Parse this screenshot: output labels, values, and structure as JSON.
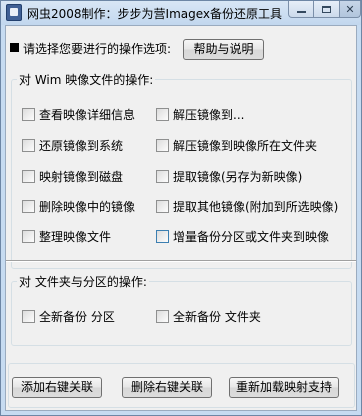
{
  "window": {
    "title": "网虫2008制作：步步为营Imagex备份还原工具"
  },
  "prompt": {
    "text": "请选择您要进行的操作选项:",
    "help_button": "帮助与说明"
  },
  "wim_group": {
    "title": "对 Wim 映像文件的操作:",
    "options": [
      "查看映像详细信息",
      "解压镜像到...",
      "还原镜像到系统",
      "解压镜像到映像所在文件夹",
      "映射镜像到磁盘",
      "提取镜像(另存为新映像)",
      "删除映像中的镜像",
      "提取其他镜像(附加到所选映像)",
      "整理映像文件",
      "增量备份分区或文件夹到映像"
    ]
  },
  "folder_group": {
    "title": "对 文件夹与分区的操作:",
    "options": [
      "全新备份 分区",
      "全新备份 文件夹"
    ]
  },
  "bottom_buttons": {
    "add_context": "添加右键关联",
    "remove_context": "删除右键关联",
    "reload_mapping": "重新加载映射支持"
  }
}
